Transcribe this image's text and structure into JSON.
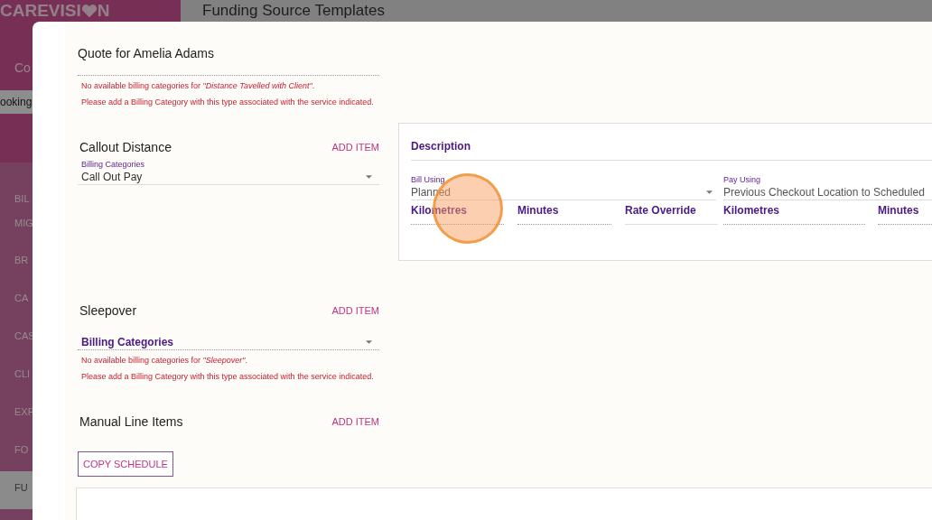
{
  "background": {
    "logo_left": "CAREVISI",
    "logo_right": "N",
    "page_title": "Funding Source Templates",
    "sidebar": {
      "heading": "Co",
      "search": {
        "value": "ooking"
      },
      "items": [
        {
          "lines": [
            "BIL",
            "MIG"
          ],
          "selected": false
        },
        {
          "lines": [
            "BR"
          ],
          "selected": false
        },
        {
          "lines": [
            "CA"
          ],
          "selected": false
        },
        {
          "lines": [
            "CAS"
          ],
          "selected": false
        },
        {
          "lines": [
            "CLI"
          ],
          "selected": false
        },
        {
          "lines": [
            "EXP"
          ],
          "selected": false
        },
        {
          "lines": [
            "FO"
          ],
          "selected": false
        },
        {
          "lines": [
            "FU"
          ],
          "selected": true
        }
      ]
    }
  },
  "dialog": {
    "title": "Quote for Amelia Adams",
    "top_errors": [
      "No available billing categories for *\"Distance Tavelled with Client\"*.",
      "Please add a Billing Category with this type associated with the service indicated."
    ],
    "sections": [
      {
        "title": "Callout Distance",
        "action": "ADD ITEM",
        "field": {
          "label": "Billing Categories",
          "value": "Call Out Pay",
          "disabled": false
        },
        "panel": {
          "heading": "Description",
          "bill_using": {
            "label": "Bill Using",
            "value": "Planned"
          },
          "pay_using": {
            "label": "Pay Using",
            "value": "Previous Checkout Location to Scheduled"
          },
          "columns": [
            {
              "label": "Kilometres",
              "disabled": true
            },
            {
              "label": "Minutes",
              "disabled": true
            },
            {
              "label": "Rate Override",
              "disabled": false
            },
            {
              "label": "Kilometres",
              "disabled": true
            },
            {
              "label": "Minutes",
              "disabled": true
            }
          ]
        }
      },
      {
        "title": "Sleepover",
        "action": "ADD ITEM",
        "field": {
          "placeholder": "Billing Categories",
          "disabled": true
        },
        "errors": [
          "No available billing categories for *\"Sleepover\"*.",
          "Please add a Billing Category with this type associated with the service indicated."
        ]
      },
      {
        "title": "Manual Line Items",
        "action": "ADD ITEM"
      }
    ],
    "button": "COPY SCHEDULE"
  }
}
